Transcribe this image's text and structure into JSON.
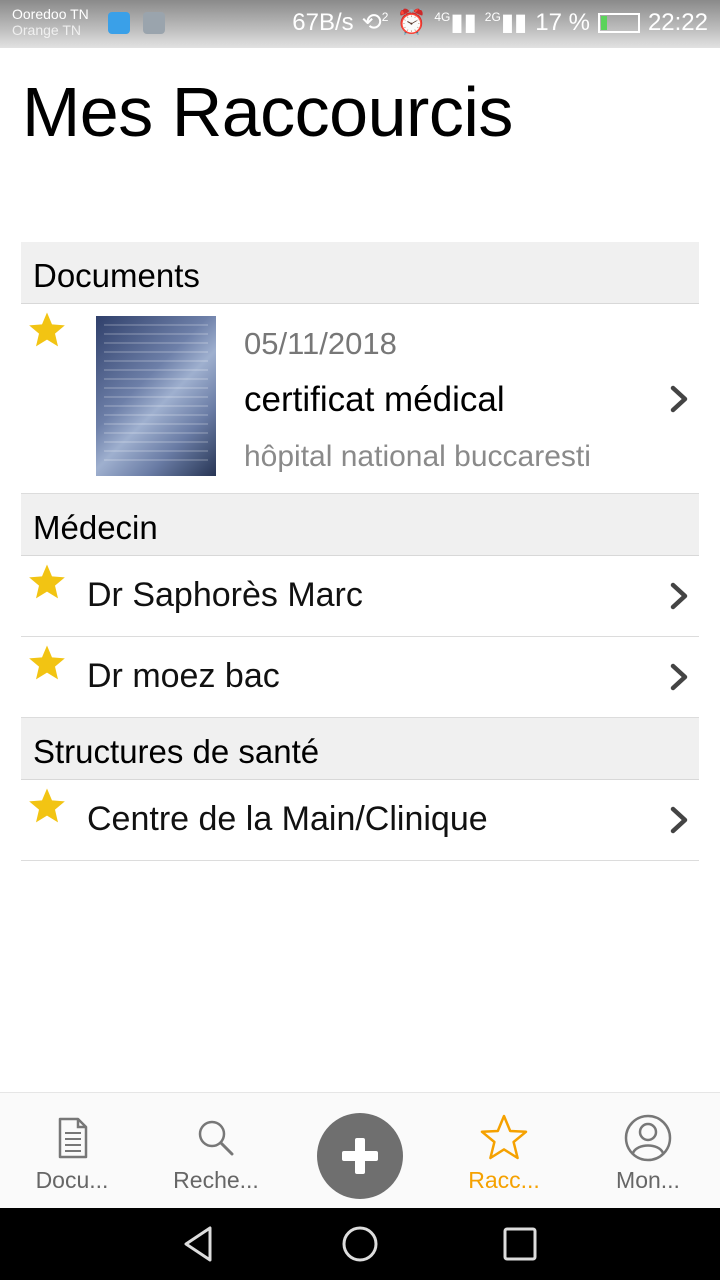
{
  "status_bar": {
    "carrier1": "Ooredoo TN",
    "carrier2": "Orange TN",
    "net_speed": "67B/s",
    "sim_num": "2",
    "net1": "4G",
    "net2": "2G",
    "battery_percent": "17 %",
    "time": "22:22"
  },
  "title": "Mes Raccourcis",
  "sections": {
    "documents": {
      "header": "Documents",
      "item": {
        "date": "05/11/2018",
        "title": "certificat médical",
        "subtitle": "hôpital national buccaresti"
      }
    },
    "medecin": {
      "header": "Médecin",
      "items": [
        "Dr Saphorès Marc",
        "Dr moez bac"
      ]
    },
    "structures": {
      "header": "Structures de santé",
      "items": [
        "Centre de la Main/Clinique"
      ]
    }
  },
  "bottom_nav": {
    "items": [
      {
        "label": "Docu...",
        "icon": "document-icon"
      },
      {
        "label": "Reche...",
        "icon": "search-icon"
      },
      {
        "label": "Racc...",
        "icon": "star-icon",
        "active": true
      },
      {
        "label": "Mon...",
        "icon": "user-icon"
      }
    ],
    "add_icon": "plus-icon"
  },
  "colors": {
    "accent": "#f5a100",
    "star": "#f2c413",
    "section_bg": "#f0f0f0",
    "fab": "#6f6f6f"
  }
}
